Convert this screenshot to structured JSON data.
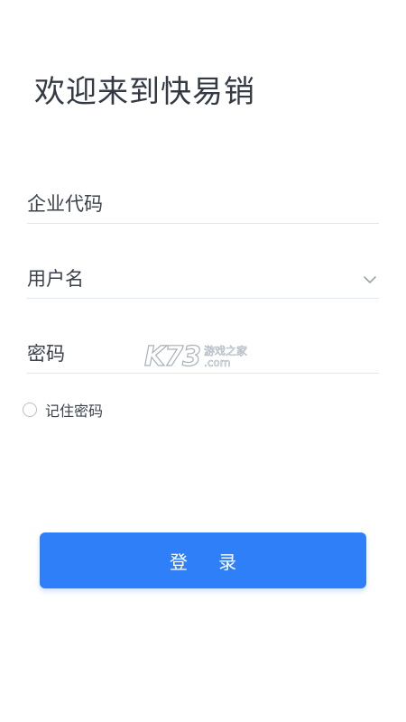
{
  "header": {
    "title": "欢迎来到快易销"
  },
  "form": {
    "company_code_placeholder": "企业代码",
    "username_placeholder": "用户名",
    "password_placeholder": "密码",
    "remember_label": "记住密码",
    "remember_checked": false,
    "login_label": "登 录"
  },
  "watermark": {
    "logo": "K73",
    "line1": "游戏之家",
    "line2": ".com"
  },
  "colors": {
    "accent": "#2f80f8",
    "text": "#333a44",
    "divider": "#dfe6ee"
  },
  "icons": {
    "dropdown": "chevron-down-icon",
    "remember": "radio-circle-icon"
  }
}
